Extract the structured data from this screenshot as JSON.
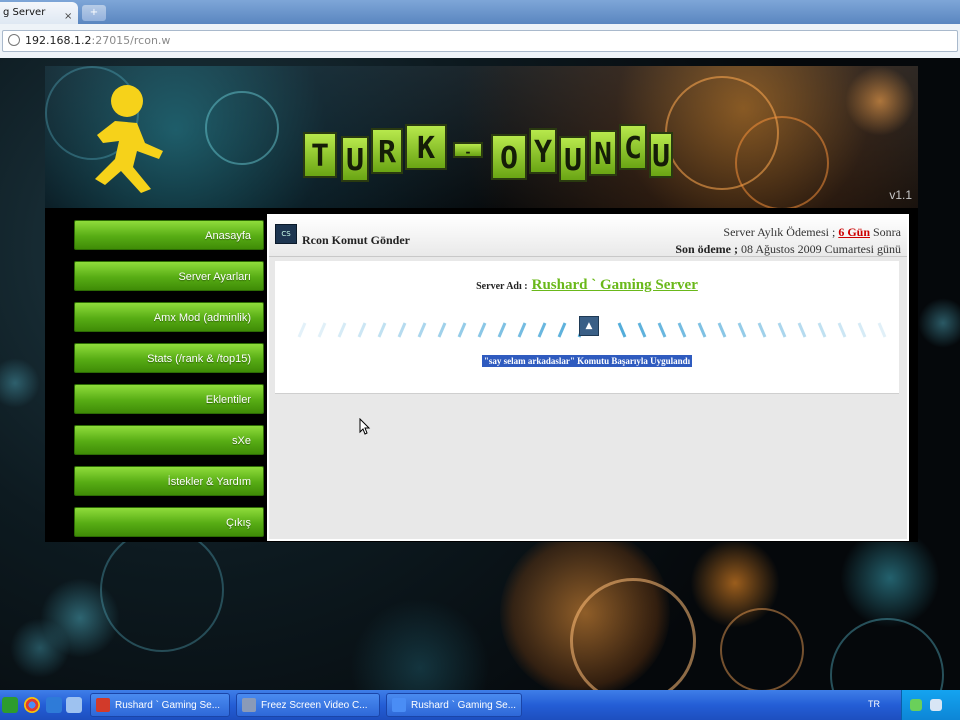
{
  "browser": {
    "tab_title": "g Server",
    "tab_close": "×",
    "new_tab": "+",
    "url_host": "192.168.1.2",
    "url_rest": ":27015/rcon.w"
  },
  "header": {
    "logo_letters": [
      "T",
      "U",
      "R",
      "K",
      "-",
      "O",
      "Y",
      "U",
      "N",
      "C",
      "U"
    ],
    "version": "v1.1"
  },
  "menu": {
    "items": [
      "Anasayfa",
      "Server Ayarları",
      "Amx Mod (adminlik)",
      "Stats (/rank & /top15)",
      "Eklentiler",
      "sXe",
      "İstekler & Yardım",
      "Çıkış"
    ]
  },
  "panel": {
    "icon_text": "CS",
    "title": "Rcon Komut Gönder",
    "payment_prefix": "Server Aylık Ödemesi ;",
    "payment_days": "6 Gün",
    "payment_suffix": "Sonra",
    "last_payment_label": "Son ödeme ;",
    "last_payment_value": "08 Ağustos 2009 Cumartesi günü",
    "server_label": "Server Adı :",
    "server_name": "Rushard ` Gaming Server",
    "result_text": "\"say selam arkadaslar\" Komutu Başarıyla Uygulandı"
  },
  "taskbar": {
    "tasks": [
      "Rushard ` Gaming Se...",
      "Freez Screen Video C...",
      "Rushard ` Gaming Se..."
    ],
    "tray_lang": "TR"
  },
  "colors": {
    "accent_green": "#6ab81a",
    "menu_green": "#57ac14",
    "highlight_blue": "#2f5bbf",
    "alert_red": "#cc0000"
  }
}
